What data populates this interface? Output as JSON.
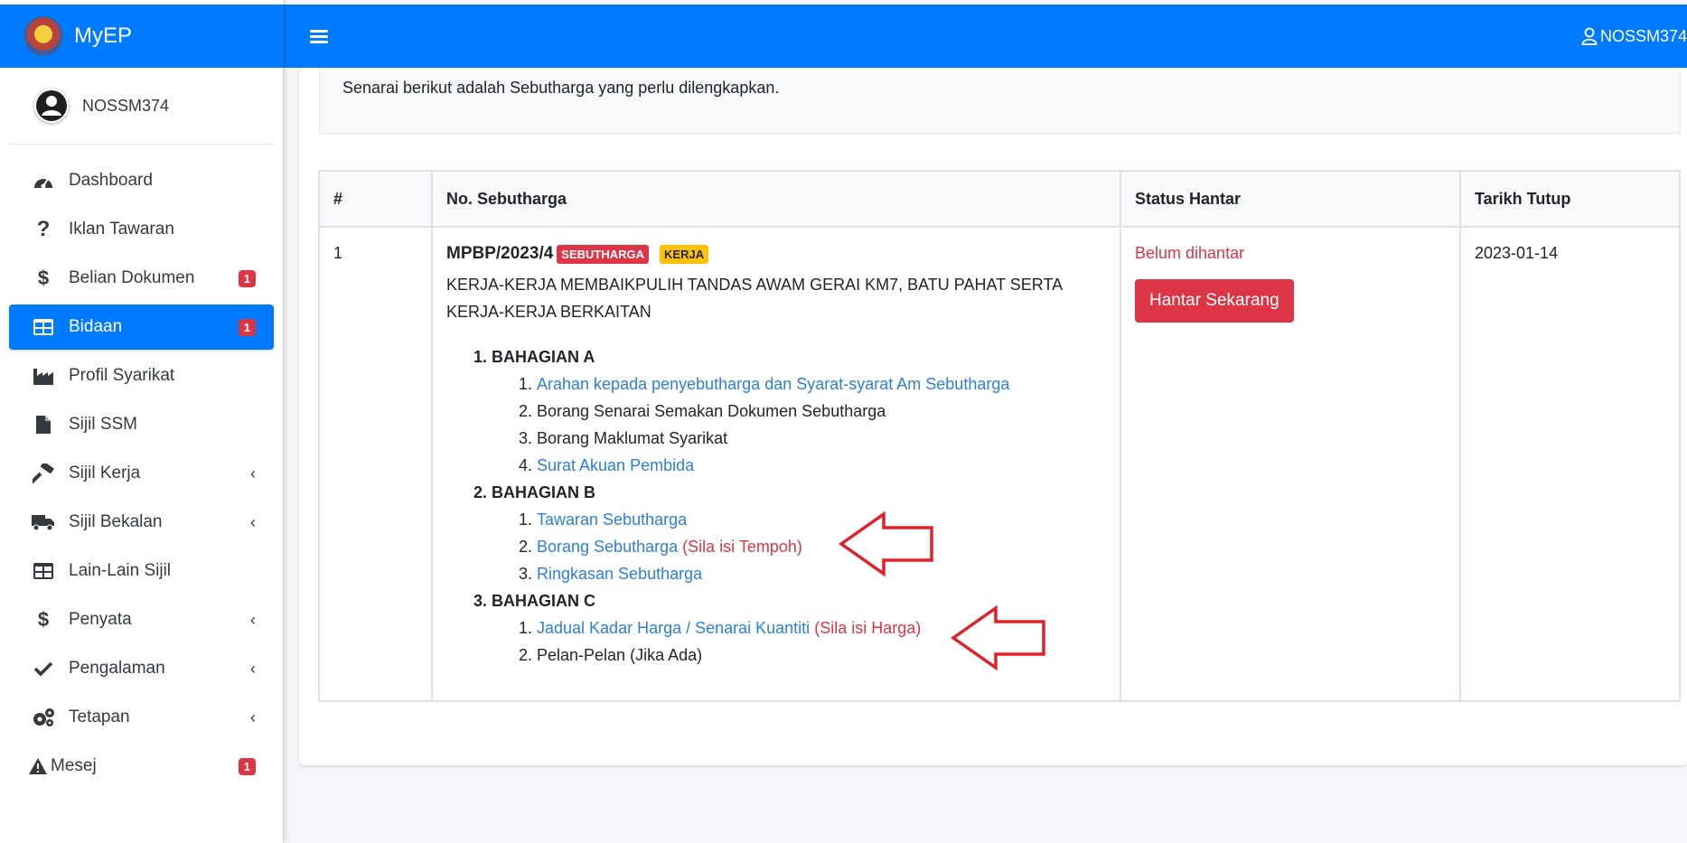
{
  "app": {
    "brand": "MyEP",
    "username": "NOSSM374",
    "top_user": "NOSSM374"
  },
  "sidebar": {
    "items": [
      {
        "label": "Dashboard",
        "icon": "gauge-icon"
      },
      {
        "label": "Iklan Tawaran",
        "icon": "question-icon"
      },
      {
        "label": "Belian Dokumen",
        "icon": "dollar-icon",
        "badge": "1"
      },
      {
        "label": "Bidaan",
        "icon": "table-icon",
        "badge": "1",
        "active": true
      },
      {
        "label": "Profil Syarikat",
        "icon": "industry-icon"
      },
      {
        "label": "Sijil SSM",
        "icon": "file-icon"
      },
      {
        "label": "Sijil Kerja",
        "icon": "hammer-icon",
        "chevron": true
      },
      {
        "label": "Sijil Bekalan",
        "icon": "truck-icon",
        "chevron": true
      },
      {
        "label": "Lain-Lain Sijil",
        "icon": "table-icon"
      },
      {
        "label": "Penyata",
        "icon": "dollar-icon",
        "chevron": true
      },
      {
        "label": "Pengalaman",
        "icon": "check-icon",
        "chevron": true
      },
      {
        "label": "Tetapan",
        "icon": "gears-icon",
        "chevron": true
      },
      {
        "label": "Mesej",
        "icon": "warning-icon",
        "badge": "1"
      }
    ]
  },
  "main": {
    "info_text": "Senarai berikut adalah Sebutharga yang perlu dilengkapkan.",
    "table": {
      "headers": [
        "#",
        "No. Sebutharga",
        "Status Hantar",
        "Tarikh Tutup"
      ],
      "row": {
        "num": "1",
        "ref": "MPBP/2023/4",
        "tag1": "SEBUTHARGA",
        "tag2": "KERJA",
        "description": "KERJA-KERJA MEMBAIKPULIH TANDAS AWAM GERAI KM7, BATU PAHAT SERTA KERJA-KERJA BERKAITAN",
        "status": "Belum dihantar",
        "submit_button": "Hantar Sekarang",
        "closing_date": "2023-01-14",
        "section_a": {
          "title": "BAHAGIAN A",
          "item1": "Arahan kepada penyebutharga dan Syarat-syarat Am Sebutharga",
          "item2": "Borang Senarai Semakan Dokumen Sebutharga",
          "item3": "Borang Maklumat Syarikat",
          "item4": "Surat Akuan Pembida"
        },
        "section_b": {
          "title": "BAHAGIAN B",
          "item1": "Tawaran Sebutharga",
          "item2": "Borang Sebutharga",
          "item2_note": "(Sila isi Tempoh)",
          "item3": "Ringkasan Sebutharga"
        },
        "section_c": {
          "title": "BAHAGIAN C",
          "item1": "Jadual Kadar Harga / Senarai Kuantiti",
          "item1_note": "(Sila isi Harga)",
          "item2": "Pelan-Pelan (Jika Ada)"
        }
      }
    }
  },
  "colors": {
    "primary": "#007bff",
    "danger": "#dc3545",
    "warning": "#ffc107",
    "link": "#2a7fe0"
  }
}
